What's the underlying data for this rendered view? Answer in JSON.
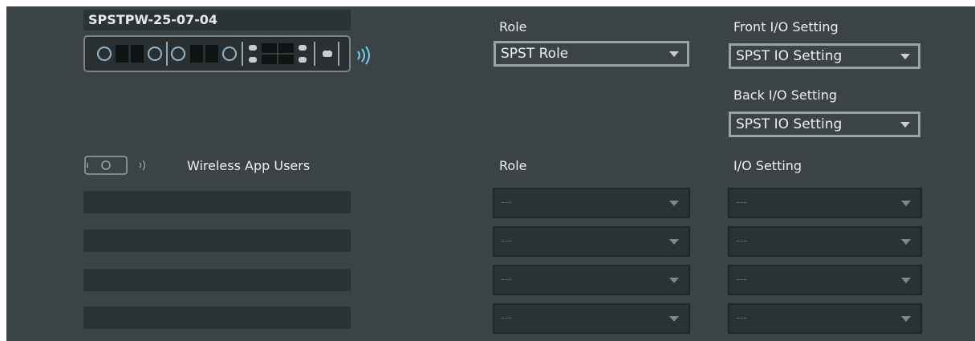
{
  "device": {
    "title": "SPSTPW-25-07-04"
  },
  "front_panel": {
    "role_label": "Role",
    "role_value": "SPST Role",
    "front_io_label": "Front I/O Setting",
    "front_io_value": "SPST IO Setting",
    "back_io_label": "Back I/O Setting",
    "back_io_value": "SPST IO Setting"
  },
  "wireless": {
    "title": "Wireless App Users",
    "role_label": "Role",
    "io_label": "I/O Setting",
    "rows": [
      {
        "role": "---",
        "io": "---"
      },
      {
        "role": "---",
        "io": "---"
      },
      {
        "role": "---",
        "io": "---"
      },
      {
        "role": "---",
        "io": "---"
      }
    ]
  },
  "colors": {
    "panel_bg": "#3b4347",
    "slot_bg": "#2c3336",
    "text": "#eceff0",
    "border": "#9aa3a6"
  }
}
